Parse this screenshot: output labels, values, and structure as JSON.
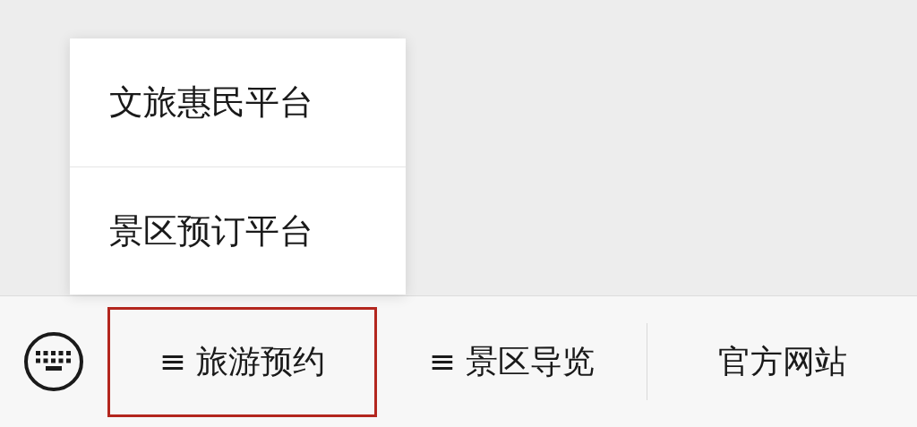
{
  "popup_menu": {
    "items": [
      {
        "label": "文旅惠民平台"
      },
      {
        "label": "景区预订平台"
      }
    ]
  },
  "bottom_bar": {
    "keyboard_button": true,
    "items": [
      {
        "label": "≡ 旅游预约",
        "highlighted": true
      },
      {
        "label": "≡ 景区导览",
        "highlighted": false
      },
      {
        "label": "官方网站",
        "highlighted": false
      }
    ]
  }
}
